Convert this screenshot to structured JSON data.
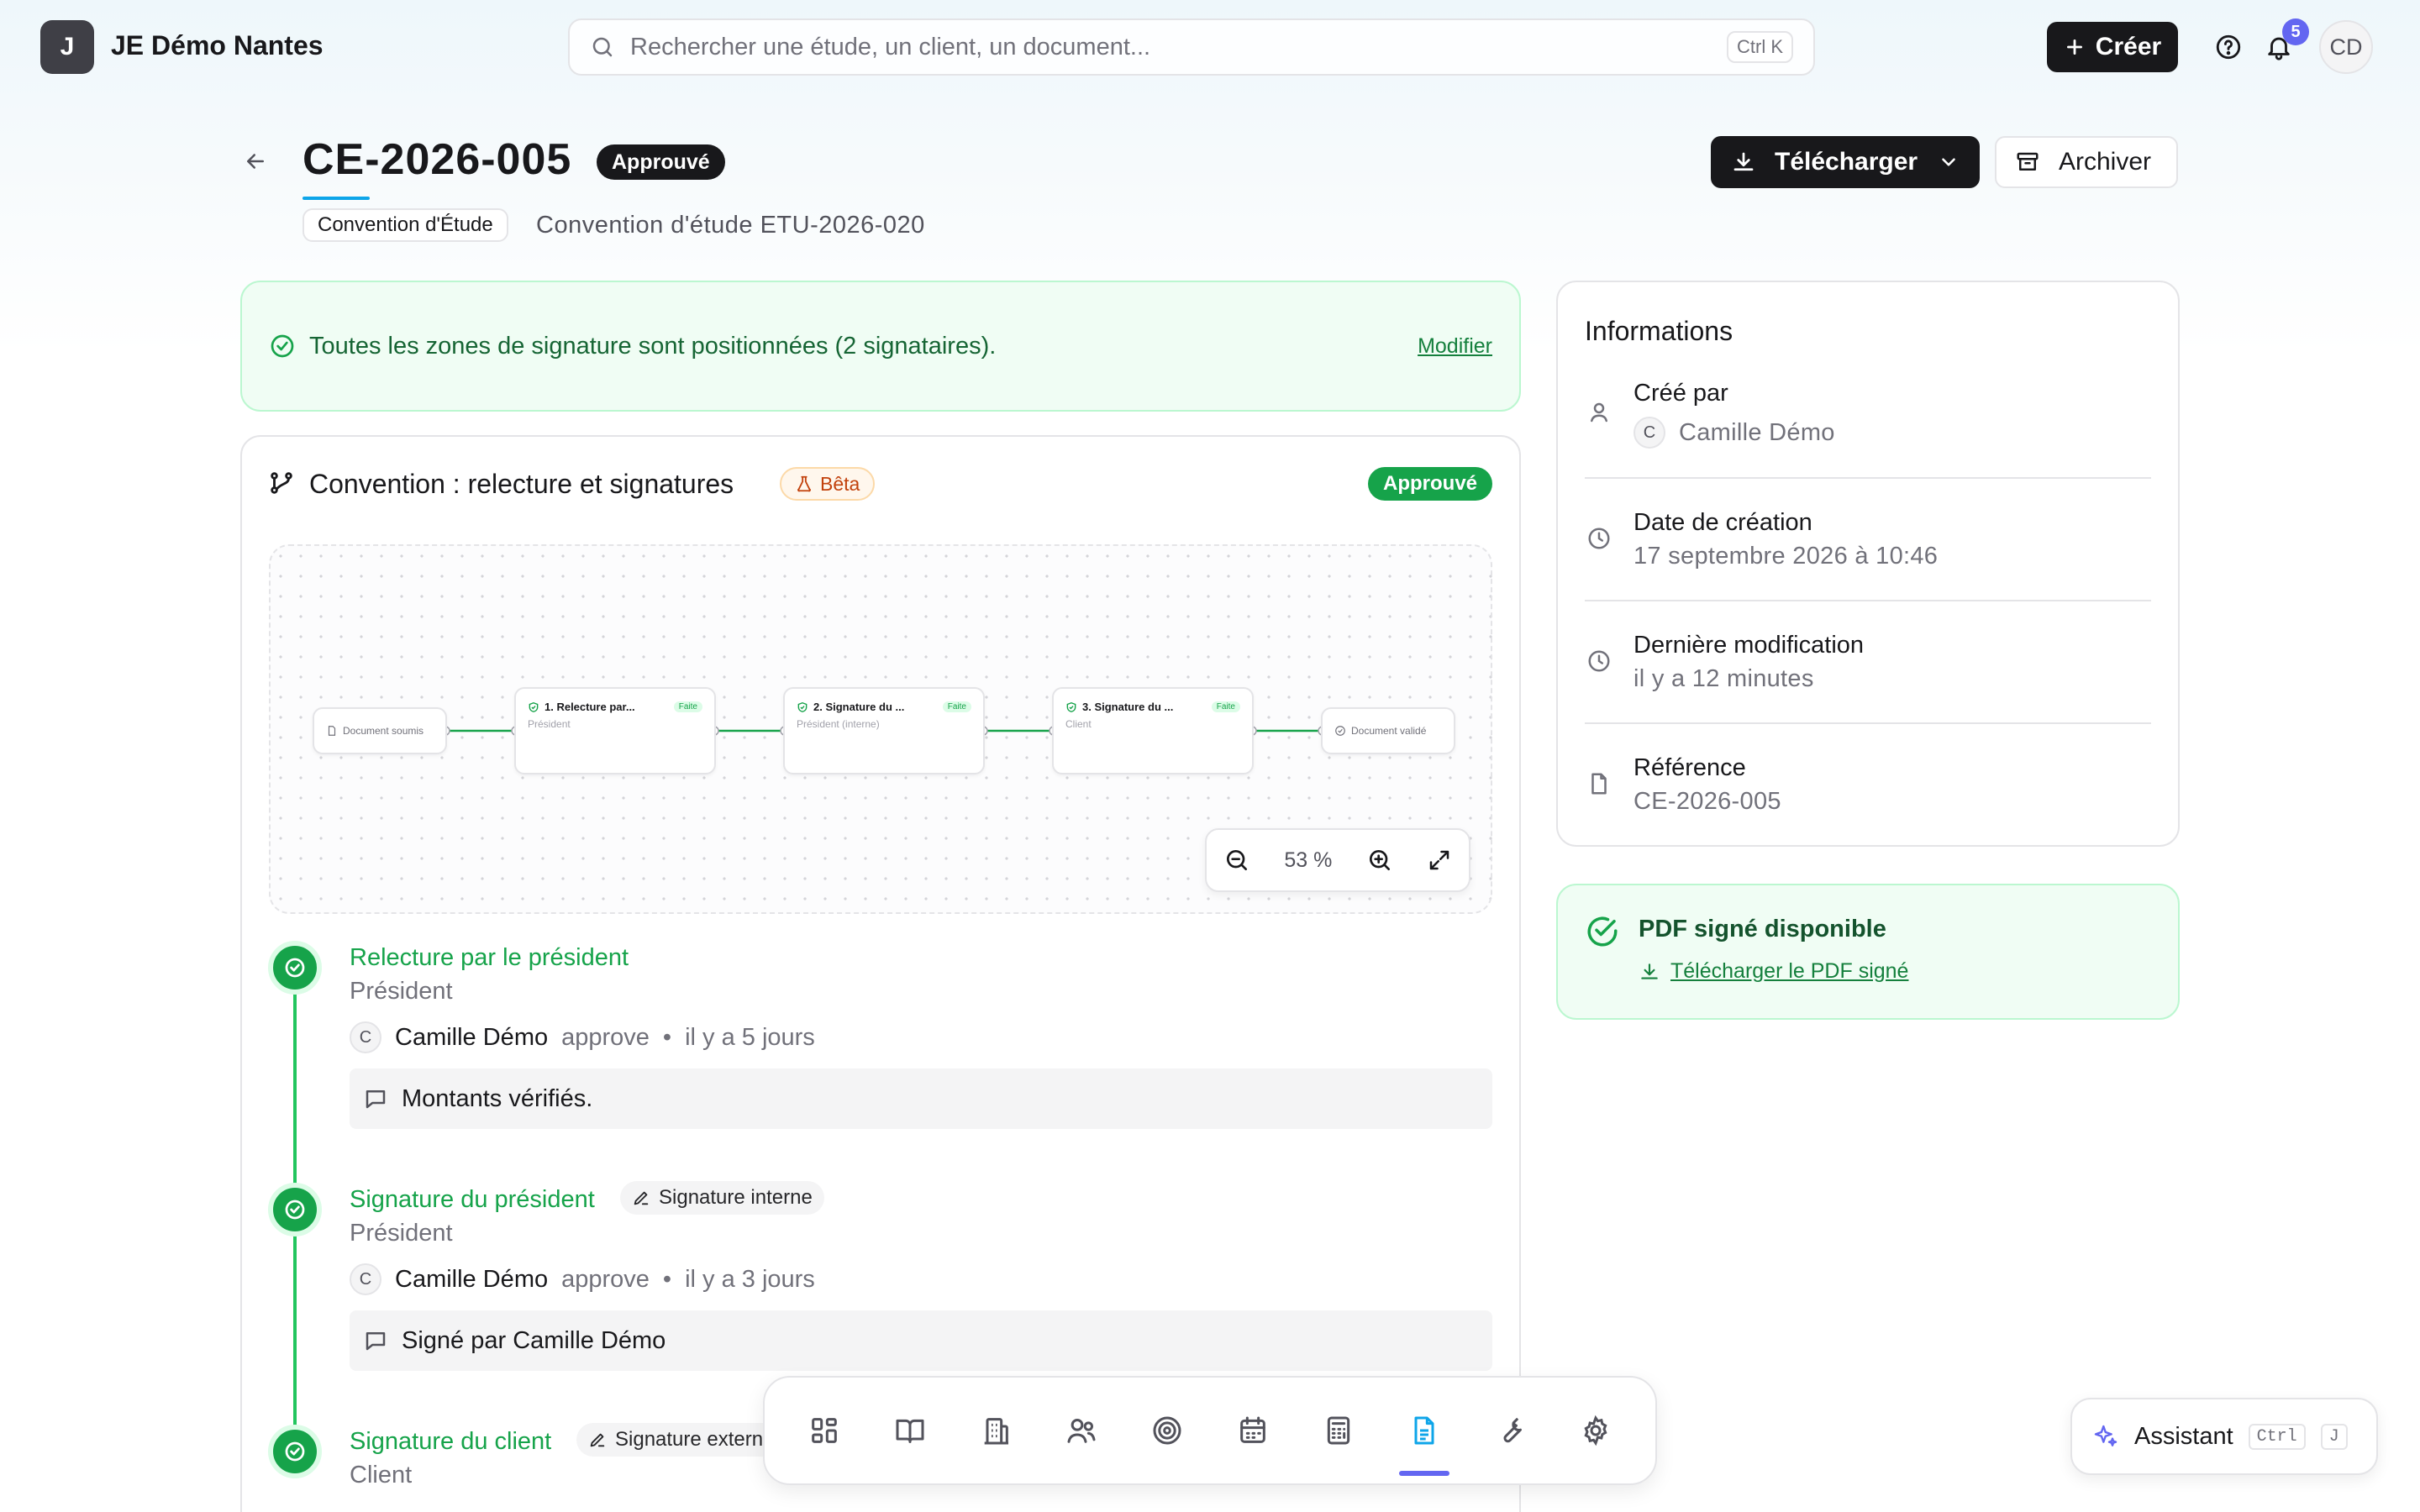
{
  "brand": {
    "logo_letter": "J",
    "name": "JE Démo Nantes"
  },
  "search": {
    "placeholder": "Rechercher une étude, un client, un document...",
    "shortcut": "Ctrl K"
  },
  "header": {
    "create_label": "Créer",
    "notif_count": "5",
    "user_initials": "CD"
  },
  "document": {
    "title": "CE-2026-005",
    "status": "Approuvé",
    "type": "Convention d'Étude",
    "subtitle": "Convention d'étude ETU-2026-020",
    "download_label": "Télécharger",
    "archive_label": "Archiver"
  },
  "alert": {
    "text": "Toutes les zones de signature sont positionnées (2 signataires).",
    "action": "Modifier"
  },
  "workflow": {
    "title": "Convention : relecture et signatures",
    "beta_label": "Bêta",
    "status": "Approuvé",
    "zoom": "53 %",
    "nodes": {
      "start": "Document soumis",
      "step1": {
        "title": "1. Relecture par...",
        "role": "Président",
        "badge": "Faite"
      },
      "step2": {
        "title": "2. Signature du ...",
        "role": "Président (interne)",
        "badge": "Faite"
      },
      "step3": {
        "title": "3. Signature du ...",
        "role": "Client",
        "badge": "Faite"
      },
      "end": "Document validé"
    },
    "steps": [
      {
        "title": "Relecture par le président",
        "role": "Président",
        "avatar": "C",
        "user": "Camille Démo",
        "action": "approve",
        "time": "il y a 5 jours",
        "comment": "Montants vérifiés."
      },
      {
        "title": "Signature du président",
        "chip": "Signature interne",
        "role": "Président",
        "avatar": "C",
        "user": "Camille Démo",
        "action": "approve",
        "time": "il y a 3 jours",
        "comment": "Signé par Camille Démo"
      },
      {
        "title": "Signature du client",
        "chip": "Signature externe",
        "role": "Client"
      }
    ]
  },
  "info": {
    "title": "Informations",
    "created_by_label": "Créé par",
    "created_by_avatar": "C",
    "created_by": "Camille Démo",
    "created_at_label": "Date de création",
    "created_at": "17 septembre 2026 à 10:46",
    "modified_label": "Dernière modification",
    "modified": "il y a 12 minutes",
    "reference_label": "Référence",
    "reference": "CE-2026-005"
  },
  "pdf": {
    "title": "PDF signé disponible",
    "link": "Télécharger le PDF signé"
  },
  "dock": {
    "items": [
      "dashboard-icon",
      "book-icon",
      "building-icon",
      "users-icon",
      "target-icon",
      "calendar-icon",
      "calculator-icon",
      "document-icon",
      "wrench-icon",
      "settings-icon"
    ],
    "active": "document-icon",
    "active_color": "#6366f1"
  },
  "assistant": {
    "label": "Assistant",
    "key1": "Ctrl",
    "key2": "J"
  },
  "colors": {
    "success": "#16a34a",
    "dark": "#18181b",
    "accent": "#0ea5e9"
  }
}
